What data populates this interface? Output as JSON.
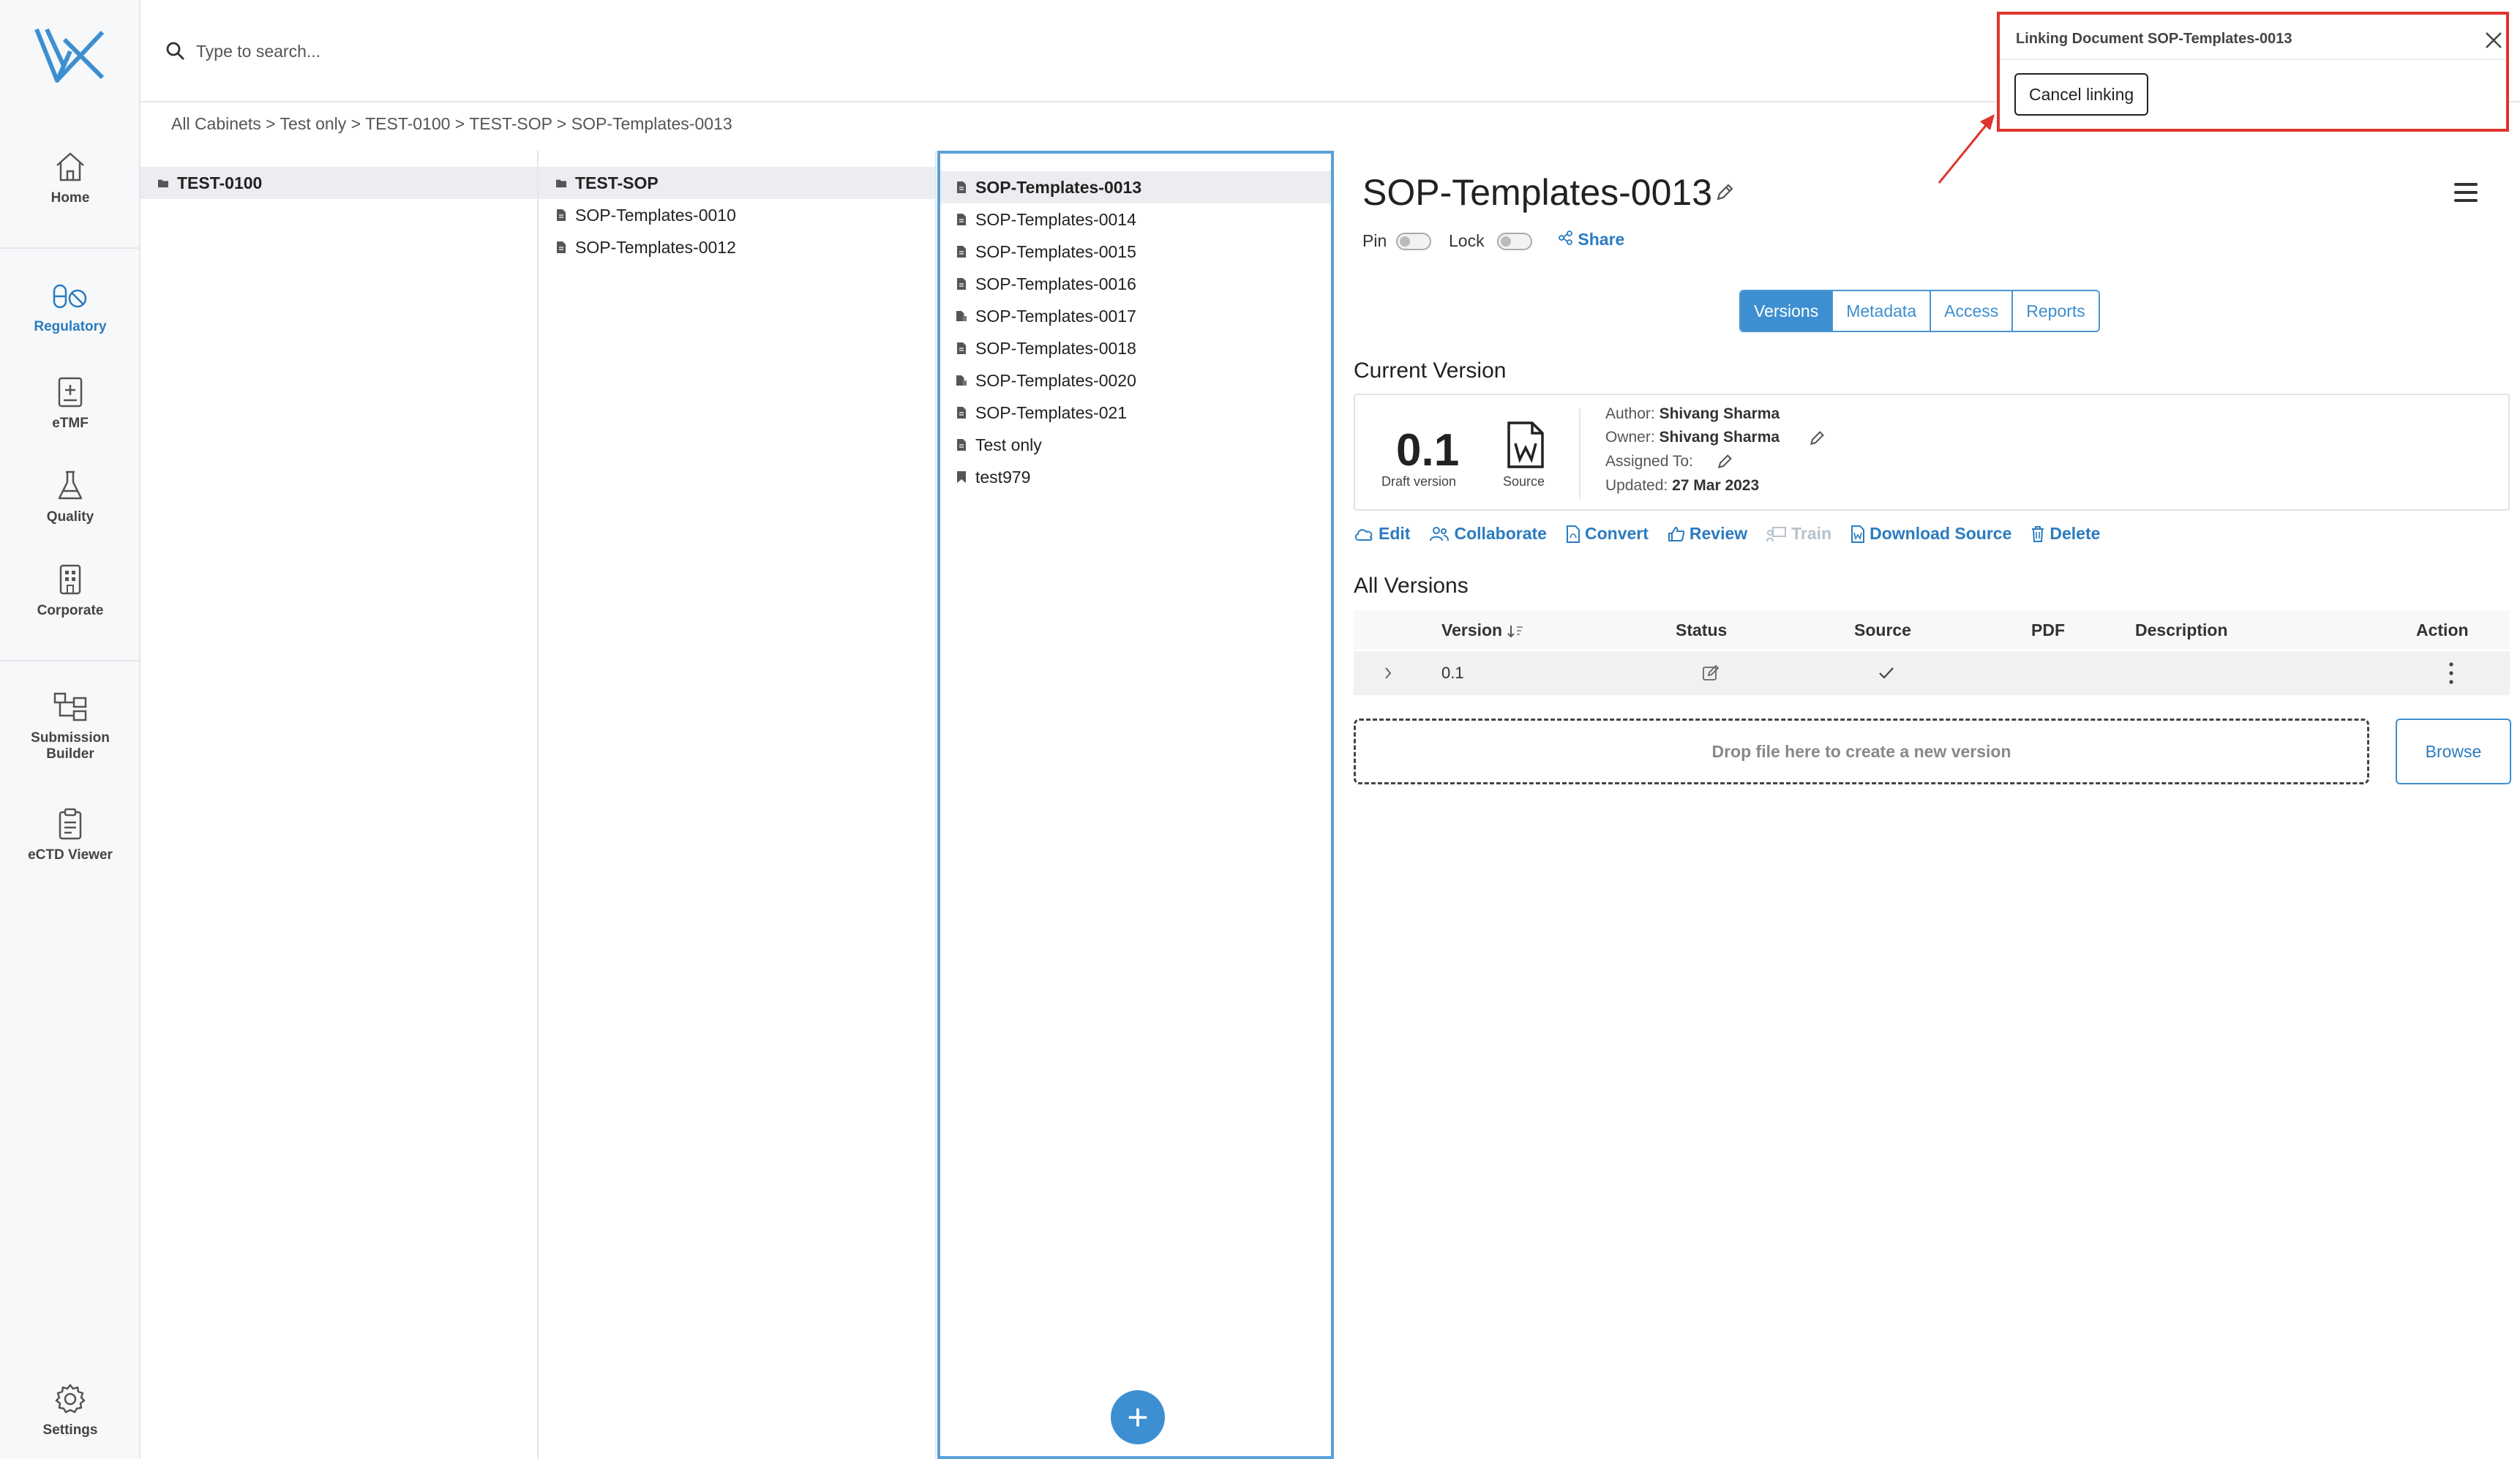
{
  "nav": {
    "home": "Home",
    "regulatory": "Regulatory",
    "etmf": "eTMF",
    "quality": "Quality",
    "corporate": "Corporate",
    "submission_builder_1": "Submission",
    "submission_builder_2": "Builder",
    "ectd_viewer": "eCTD Viewer",
    "settings": "Settings"
  },
  "search": {
    "placeholder": "Type to search..."
  },
  "breadcrumb": "All Cabinets > Test only > TEST-0100 > TEST-SOP > SOP-Templates-0013",
  "column1": {
    "items": [
      {
        "label": "TEST-0100",
        "icon": "folder-icon"
      }
    ]
  },
  "column2": {
    "items": [
      {
        "label": "TEST-SOP",
        "icon": "folder-icon"
      },
      {
        "label": "SOP-Templates-0010",
        "icon": "document-icon"
      },
      {
        "label": "SOP-Templates-0012",
        "icon": "document-icon"
      }
    ]
  },
  "column3": {
    "items": [
      {
        "label": "SOP-Templates-0013",
        "icon": "document-icon"
      },
      {
        "label": "SOP-Templates-0014",
        "icon": "document-icon"
      },
      {
        "label": "SOP-Templates-0015",
        "icon": "document-icon"
      },
      {
        "label": "SOP-Templates-0016",
        "icon": "document-icon"
      },
      {
        "label": "SOP-Templates-0017",
        "icon": "linked-document-icon"
      },
      {
        "label": "SOP-Templates-0018",
        "icon": "document-icon"
      },
      {
        "label": "SOP-Templates-0020",
        "icon": "linked-document-icon"
      },
      {
        "label": "SOP-Templates-021",
        "icon": "document-icon"
      },
      {
        "label": "Test only",
        "icon": "document-icon"
      },
      {
        "label": "test979",
        "icon": "bookmark-icon"
      }
    ],
    "add_label": "+"
  },
  "detail": {
    "title": "SOP-Templates-0013",
    "pin_label": "Pin",
    "lock_label": "Lock",
    "share_label": "Share",
    "tabs": [
      "Versions",
      "Metadata",
      "Access",
      "Reports"
    ],
    "current_version_heading": "Current Version",
    "version_number": "0.1",
    "version_label": "Draft version",
    "source_label": "Source",
    "author_label": "Author:",
    "author": "Shivang Sharma",
    "owner_label": "Owner:",
    "owner": "Shivang Sharma",
    "assigned_label": "Assigned To:",
    "updated_label": "Updated:",
    "updated": "27 Mar 2023",
    "actions": {
      "edit": "Edit",
      "collaborate": "Collaborate",
      "convert": "Convert",
      "review": "Review",
      "train": "Train",
      "download_source": "Download Source",
      "delete": "Delete"
    },
    "all_versions_heading": "All Versions",
    "table_headers": [
      "Version",
      "Status",
      "Source",
      "PDF",
      "Description",
      "Action"
    ],
    "rows": [
      {
        "version": "0.1"
      }
    ],
    "dropzone": "Drop file here to create a new version",
    "browse": "Browse"
  },
  "popup": {
    "title": "Linking Document SOP-Templates-0013",
    "cancel": "Cancel linking"
  },
  "colors": {
    "accent": "#3d8fd1",
    "highlight": "#e0342c"
  }
}
